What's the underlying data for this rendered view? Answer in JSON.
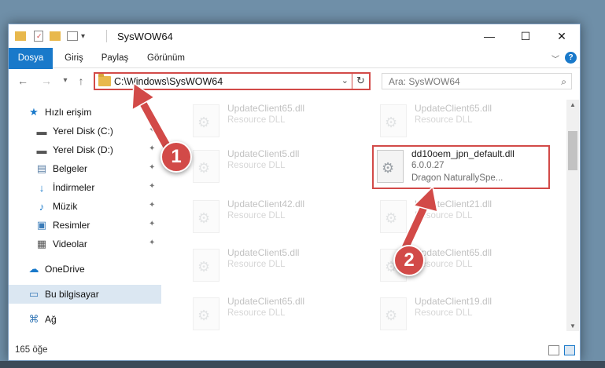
{
  "window": {
    "title": "SysWOW64",
    "controls": {
      "minimize": "—",
      "maximize": "☐",
      "close": "✕"
    }
  },
  "quick_access_toolbar": {
    "icons": [
      "folder-icon",
      "properties-icon",
      "new-folder-icon",
      "customize-icon"
    ],
    "dropdown": "▾"
  },
  "ribbon": {
    "tabs": [
      {
        "label": "Dosya",
        "active": true
      },
      {
        "label": "Giriş",
        "active": false
      },
      {
        "label": "Paylaş",
        "active": false
      },
      {
        "label": "Görünüm",
        "active": false
      }
    ],
    "help": "?"
  },
  "navigation": {
    "back": "←",
    "forward": "→",
    "recent": "▾",
    "up": "↑",
    "address": "C:\\Windows\\SysWOW64",
    "refresh": "↻",
    "search_placeholder": "Ara: SysWOW64",
    "search_icon": "⌕"
  },
  "sidebar": {
    "items": [
      {
        "label": "Hızlı erişim",
        "icon": "star-icon",
        "glyph": "★",
        "color": "#1979ca",
        "pinned": false
      },
      {
        "label": "Yerel Disk (C:)",
        "icon": "drive-c-icon",
        "glyph": "▬",
        "color": "#555555",
        "pinned": true
      },
      {
        "label": "Yerel Disk (D:)",
        "icon": "drive-d-icon",
        "glyph": "▬",
        "color": "#555555",
        "pinned": true
      },
      {
        "label": "Belgeler",
        "icon": "documents-icon",
        "glyph": "▤",
        "color": "#5b7fa6",
        "pinned": true
      },
      {
        "label": "İndirmeler",
        "icon": "downloads-icon",
        "glyph": "↓",
        "color": "#1979ca",
        "pinned": true
      },
      {
        "label": "Müzik",
        "icon": "music-icon",
        "glyph": "♪",
        "color": "#1979ca",
        "pinned": true
      },
      {
        "label": "Resimler",
        "icon": "pictures-icon",
        "glyph": "▣",
        "color": "#3a7bb8",
        "pinned": true
      },
      {
        "label": "Videolar",
        "icon": "videos-icon",
        "glyph": "▦",
        "color": "#555555",
        "pinned": true
      },
      {
        "label": "OneDrive",
        "icon": "cloud-icon",
        "glyph": "☁",
        "color": "#1979ca",
        "pinned": false
      },
      {
        "label": "Bu bilgisayar",
        "icon": "computer-icon",
        "glyph": "▭",
        "color": "#3a7bb8",
        "pinned": false,
        "selected": true
      },
      {
        "label": "Ağ",
        "icon": "network-icon",
        "glyph": "⌘",
        "color": "#3a7bb8",
        "pinned": false
      }
    ],
    "pin_glyph": "📌"
  },
  "files": [
    {
      "name": "UpdateClient65.dll",
      "meta1": "Resource DLL",
      "meta2": "",
      "faded": true
    },
    {
      "name": "UpdateClient65.dll",
      "meta1": "Resource DLL",
      "meta2": "",
      "faded": true
    },
    {
      "name": "UpdateClient5.dll",
      "meta1": "Resource DLL",
      "meta2": "",
      "faded": true
    },
    {
      "name": "dd10oem_jpn_default.dll",
      "meta1": "6.0.0.27",
      "meta2": "Dragon NaturallySpe...",
      "faded": false,
      "highlight": true
    },
    {
      "name": "UpdateClient42.dll",
      "meta1": "Resource DLL",
      "meta2": "",
      "faded": true
    },
    {
      "name": "UpdateClient21.dll",
      "meta1": "Resource DLL",
      "meta2": "",
      "faded": true
    },
    {
      "name": "UpdateClient5.dll",
      "meta1": "Resource DLL",
      "meta2": "",
      "faded": true
    },
    {
      "name": "UpdateClient65.dll",
      "meta1": "Resource DLL",
      "meta2": "",
      "faded": true
    },
    {
      "name": "UpdateClient65.dll",
      "meta1": "Resource DLL",
      "meta2": "",
      "faded": true
    },
    {
      "name": "UpdateClient19.dll",
      "meta1": "Resource DLL",
      "meta2": "",
      "faded": true
    }
  ],
  "status": {
    "item_count": "165 öğe"
  },
  "annotations": {
    "badge1": "1",
    "badge2": "2",
    "accent": "#d24a48"
  },
  "colors": {
    "ribbon_file_tab": "#1979ca",
    "selection": "#dbe7f2",
    "highlight": "#d24a48"
  }
}
